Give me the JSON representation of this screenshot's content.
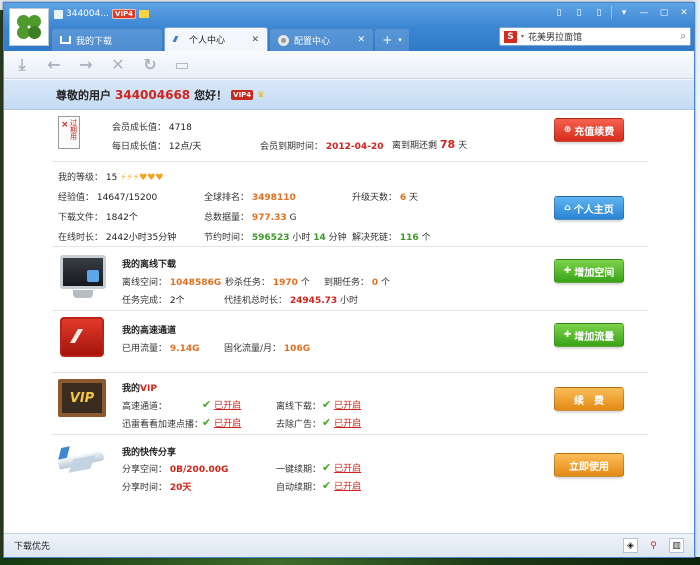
{
  "titlebar": {
    "uid_short": "344004...",
    "vip_badge": "VIP4",
    "controls": [
      "▯",
      "▯",
      "▯",
      "▾",
      "—",
      "▢",
      "✕"
    ]
  },
  "tabs": [
    {
      "label": "我的下载"
    },
    {
      "label": "个人中心"
    },
    {
      "label": "配置中心"
    }
  ],
  "tab_new": {
    "plus": "+",
    "dropdown": "▾"
  },
  "search": {
    "logo": "S",
    "value": "花美男拉面馆",
    "button": "⌕"
  },
  "toolbar": {
    "icons": [
      "⤓",
      "←",
      "→",
      "✕",
      "↻",
      "▭"
    ]
  },
  "banner": {
    "prefix": "尊敬的用户",
    "uid": "344004668",
    "suffix": "您好！",
    "vip": "VIP4",
    "crown": "♛"
  },
  "membership": {
    "expire_x": "×",
    "expire_text": "过期用",
    "growth_label": "会员成长值：",
    "growth_value": "4718",
    "daily_label": "每日成长值：",
    "daily_value": "12点/天",
    "expiry_label": "会员到期时间：",
    "expiry_value": "2012-04-20",
    "remain_label": "离到期还剩",
    "remain_value": "78",
    "remain_unit": "天",
    "button": "充值续费",
    "button_icon": "⊕"
  },
  "stats": {
    "level_label": "我的等级：",
    "level_value": "15",
    "level_icons": "⚡⚡⚡♥♥♥",
    "exp_label": "经验值：",
    "exp_value": "14647/15200",
    "rank_label": "全球排名：",
    "rank_value": "3498110",
    "upgrade_label": "升级天数：",
    "upgrade_value": "6",
    "upgrade_unit": "天",
    "files_label": "下载文件：",
    "files_value": "1842个",
    "total_label": "总数据量：",
    "total_value": "977.33",
    "total_unit": "G",
    "online_label": "在线时长：",
    "online_value": "2442小时35分钟",
    "saved_label": "节约时间：",
    "saved_hours": "596523",
    "saved_mid": "小时",
    "saved_mins": "14",
    "saved_end": "分钟",
    "deadlock_label": "解决死链：",
    "deadlock_value": "116",
    "deadlock_unit": "个",
    "button": "个人主页",
    "button_icon": "⌂"
  },
  "offline": {
    "title": "我的离线下载",
    "space_label": "离线空间：",
    "space_value": "1048586G",
    "instant_label": "秒杀任务：",
    "instant_value": "1970",
    "instant_unit": "个",
    "expire_label": "到期任务：",
    "expire_value": "0",
    "expire_unit": "个",
    "done_label": "任务完成：",
    "done_value": "2个",
    "hang_label": "代挂机总时长：",
    "hang_value": "24945.73",
    "hang_unit": "小时",
    "button": "增加空间",
    "button_icon": "✚"
  },
  "highspeed": {
    "title": "我的高速通道",
    "used_label": "已用流量：",
    "used_value": "9.14G",
    "fixed_label": "固化流量/月：",
    "fixed_value": "106G",
    "button": "增加流量",
    "button_icon": "✚"
  },
  "vip": {
    "title_prefix": "我的",
    "title_red": "VIP",
    "board": "VIP",
    "fast_label": "高速通道：",
    "fast_status": "已开启",
    "offline_label": "离线下载：",
    "offline_status": "已开启",
    "xunlei_label": "迅雷看看加速点播：",
    "xunlei_status": "已开启",
    "ads_label": "去除广告：",
    "ads_status": "已开启",
    "check": "✔",
    "button": "续　费"
  },
  "share": {
    "title": "我的快传分享",
    "space_label": "分享空间：",
    "space_value": "0B/200.00G",
    "renew_label": "一键续期：",
    "renew_status": "已开启",
    "time_label": "分享时间：",
    "time_value": "20天",
    "auto_label": "自动续期：",
    "auto_status": "已开启",
    "check": "✔",
    "button": "立即使用"
  },
  "statusbar": {
    "label": "下载优先",
    "icons": [
      "◈",
      "⚲",
      "▥"
    ]
  }
}
